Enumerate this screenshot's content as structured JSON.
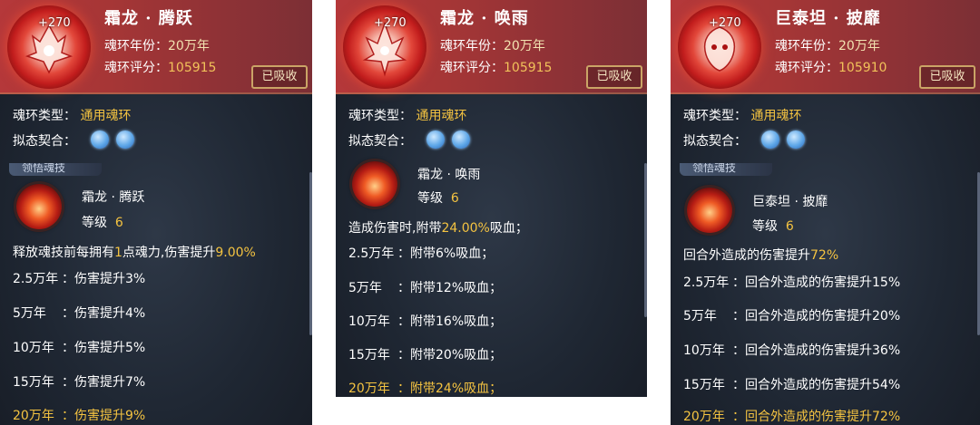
{
  "labels": {
    "year": "魂环年份：",
    "score": "魂环评分：",
    "type": "魂环类型：",
    "bond": "拟态契合：",
    "level": "等级",
    "absorbed": "已吸收",
    "section": "领悟魂技"
  },
  "cards": [
    {
      "plus": "+270",
      "name": "霜龙 · 腾跃",
      "year": "20万年",
      "score": "105915",
      "type": "通用魂环",
      "skill_name": "霜龙 · 腾跃",
      "skill_level": "6",
      "desc_prefix": "释放魂技前每拥有",
      "desc_mid1": "1",
      "desc_mid2": "点魂力,伤害提升",
      "desc_value": "9.00%",
      "tiers": [
        {
          "year": "2.5万年",
          "sep": "：",
          "effect": "伤害提升3%"
        },
        {
          "year": "5万年",
          "sep": "：",
          "effect": "伤害提升4%"
        },
        {
          "year": "10万年",
          "sep": "：",
          "effect": "伤害提升5%"
        },
        {
          "year": "15万年",
          "sep": "：",
          "effect": "伤害提升7%"
        },
        {
          "year": "20万年",
          "sep": "：",
          "effect": "伤害提升9%"
        }
      ]
    },
    {
      "plus": "+270",
      "name": "霜龙 · 唤雨",
      "year": "20万年",
      "score": "105915",
      "type": "通用魂环",
      "skill_name": "霜龙 · 唤雨",
      "skill_level": "6",
      "desc_prefix": "造成伤害时,附带",
      "desc_value": "24.00%",
      "desc_suffix": "吸血；",
      "tiers": [
        {
          "year": "2.5万年",
          "sep": "：",
          "effect": "附带6%吸血；"
        },
        {
          "year": "5万年",
          "sep": "：",
          "effect": "附带12%吸血；"
        },
        {
          "year": "10万年",
          "sep": "：",
          "effect": "附带16%吸血；"
        },
        {
          "year": "15万年",
          "sep": "：",
          "effect": "附带20%吸血；"
        },
        {
          "year": "20万年",
          "sep": "：",
          "effect": "附带24%吸血；"
        }
      ]
    },
    {
      "plus": "+270",
      "name": "巨泰坦 · 披靡",
      "year": "20万年",
      "score": "105910",
      "type": "通用魂环",
      "skill_name": "巨泰坦 · 披靡",
      "skill_level": "6",
      "desc_prefix": "回合外造成的伤害提升",
      "desc_value": "72%",
      "tiers": [
        {
          "year": "2.5万年",
          "sep": "：",
          "effect": "回合外造成的伤害提升15%"
        },
        {
          "year": "5万年",
          "sep": "：",
          "effect": "回合外造成的伤害提升20%"
        },
        {
          "year": "10万年",
          "sep": "：",
          "effect": "回合外造成的伤害提升36%"
        },
        {
          "year": "15万年",
          "sep": "：",
          "effect": "回合外造成的伤害提升54%"
        },
        {
          "year": "20万年",
          "sep": "：",
          "effect": "回合外造成的伤害提升72%"
        }
      ]
    }
  ],
  "colors": {
    "header": "#a63636",
    "panel": "#1f2733",
    "highlight": "#f4c341",
    "border": "#caa466"
  }
}
